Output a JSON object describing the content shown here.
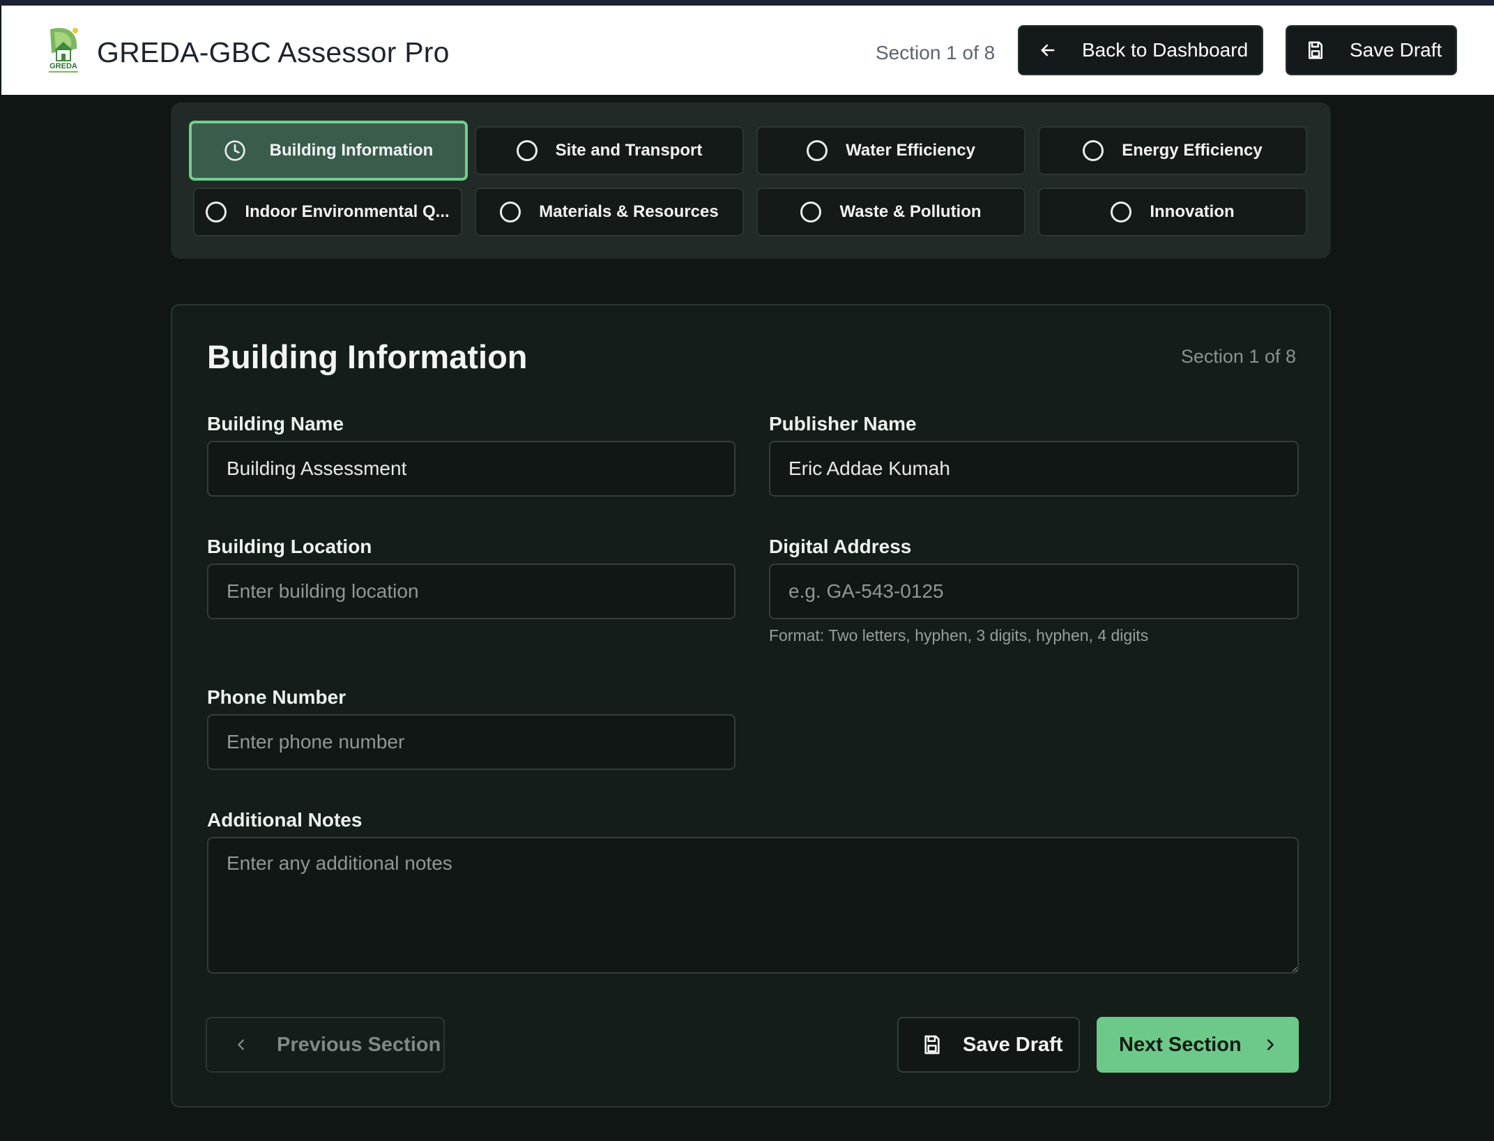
{
  "header": {
    "app_title": "GREDA-GBC Assessor Pro",
    "section_indicator": "Section 1 of 8",
    "back_button": "Back to Dashboard",
    "save_draft_button": "Save Draft",
    "logo_text": "GREDA"
  },
  "tabs": [
    {
      "label": "Building Information",
      "state": "active",
      "icon": "clock-icon"
    },
    {
      "label": "Site and Transport",
      "state": "pending",
      "icon": "circle-icon"
    },
    {
      "label": "Water Efficiency",
      "state": "pending",
      "icon": "circle-icon"
    },
    {
      "label": "Energy Efficiency",
      "state": "pending",
      "icon": "circle-icon"
    },
    {
      "label": "Indoor Environmental Q...",
      "state": "pending",
      "icon": "circle-icon"
    },
    {
      "label": "Materials & Resources",
      "state": "pending",
      "icon": "circle-icon"
    },
    {
      "label": "Waste & Pollution",
      "state": "pending",
      "icon": "circle-icon"
    },
    {
      "label": "Innovation",
      "state": "pending",
      "icon": "circle-icon"
    }
  ],
  "form": {
    "title": "Building Information",
    "section_indicator": "Section 1 of 8",
    "building_name": {
      "label": "Building Name",
      "value": "Building Assessment",
      "placeholder": ""
    },
    "publisher_name": {
      "label": "Publisher Name",
      "value": "Eric Addae Kumah",
      "placeholder": ""
    },
    "building_location": {
      "label": "Building Location",
      "value": "",
      "placeholder": "Enter building location"
    },
    "digital_address": {
      "label": "Digital Address",
      "value": "",
      "placeholder": "e.g. GA-543-0125",
      "hint": "Format: Two letters, hyphen, 3 digits, hyphen, 4 digits"
    },
    "phone_number": {
      "label": "Phone Number",
      "value": "",
      "placeholder": "Enter phone number"
    },
    "additional_notes": {
      "label": "Additional Notes",
      "value": "",
      "placeholder": "Enter any additional notes"
    }
  },
  "footer": {
    "previous_button": "Previous Section",
    "save_draft_button": "Save Draft",
    "next_button": "Next Section"
  },
  "colors": {
    "accent_green": "#6cc98a",
    "active_tab_bg": "#3a5c4b",
    "page_bg": "#0f1613"
  }
}
